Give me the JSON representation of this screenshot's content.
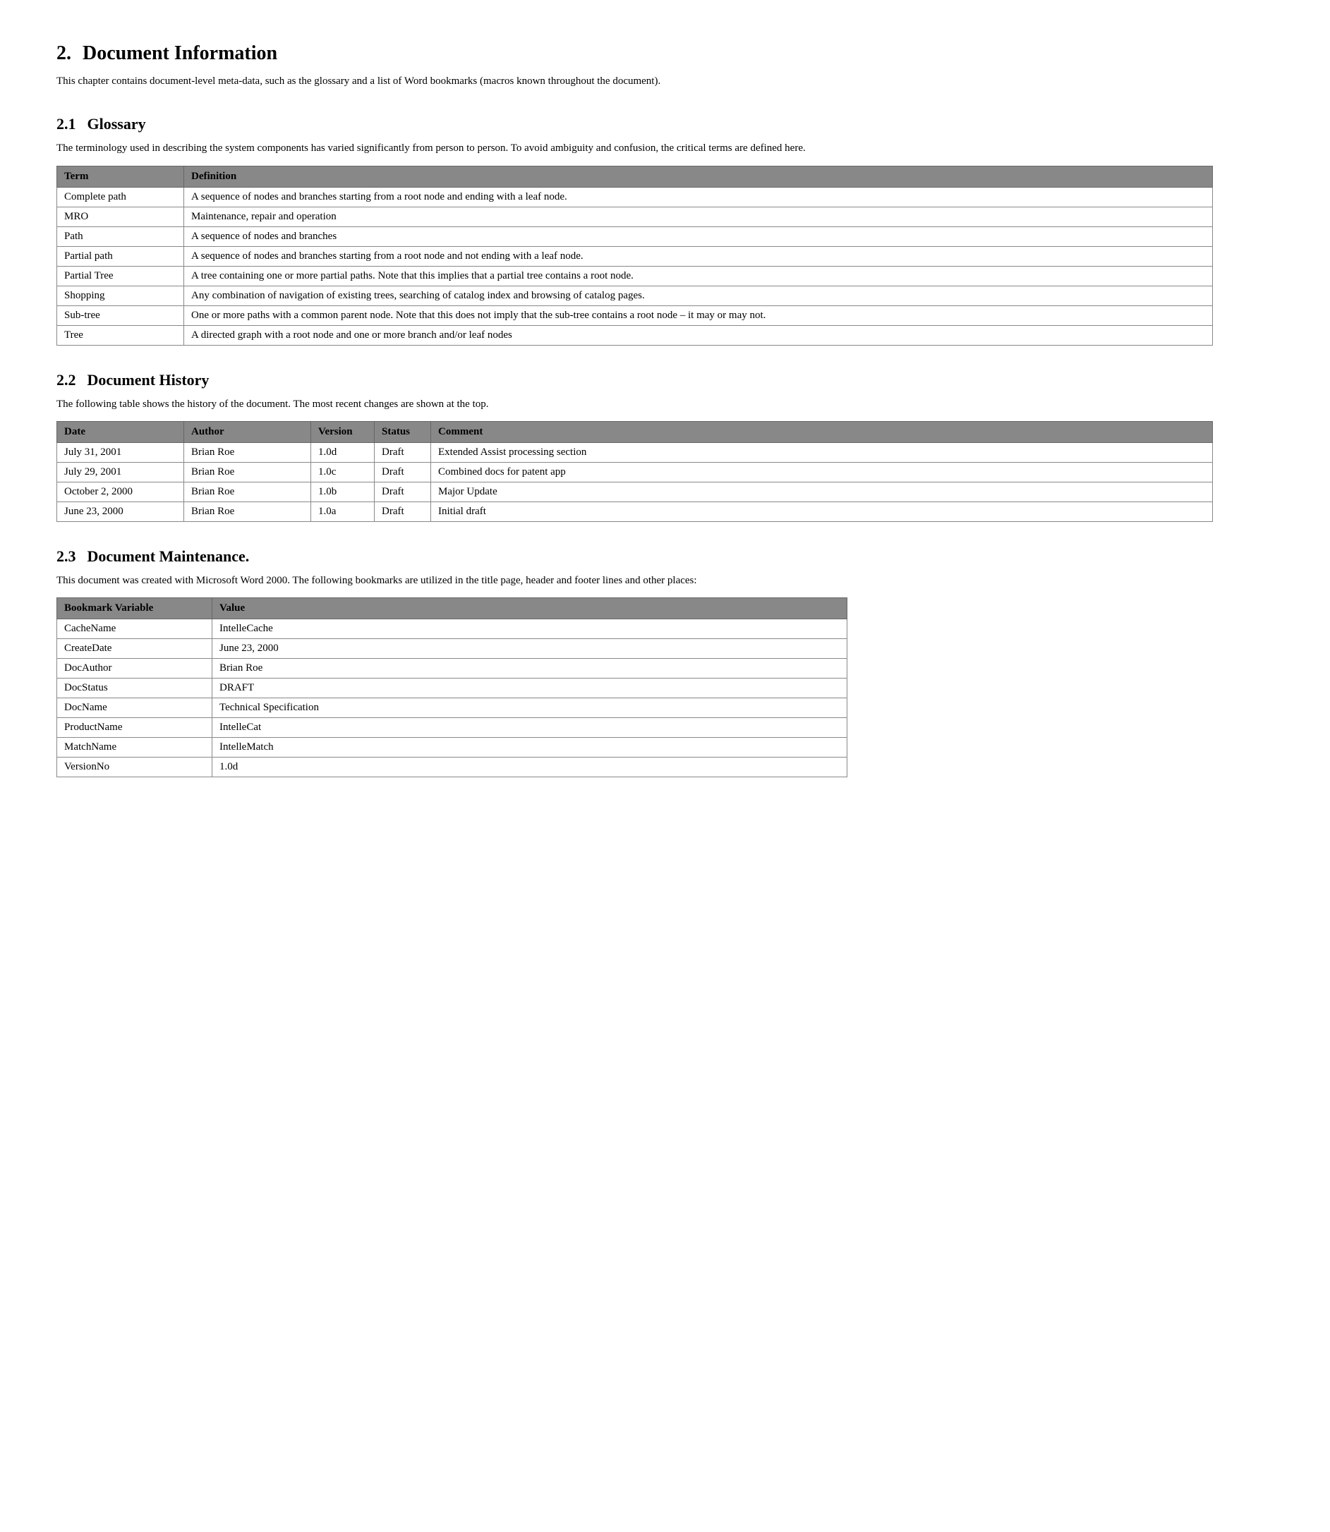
{
  "section": {
    "number": "2.",
    "title": "Document Information",
    "intro": "This chapter contains document-level meta-data, such as the glossary and a list of Word bookmarks (macros known throughout the document)."
  },
  "glossary": {
    "number": "2.1",
    "title": "Glossary",
    "intro": "The terminology used in describing the system components has varied significantly from person to person.  To avoid ambiguity and confusion, the critical terms are defined here.",
    "table_headers": [
      "Term",
      "Definition"
    ],
    "rows": [
      {
        "term": "Complete path",
        "definition": "A sequence of nodes and branches starting from a root node and ending with a leaf node."
      },
      {
        "term": "MRO",
        "definition": "Maintenance, repair and operation"
      },
      {
        "term": "Path",
        "definition": "A sequence of nodes and branches"
      },
      {
        "term": "Partial path",
        "definition": "A sequence of nodes and branches starting from a root node and not ending with a leaf node."
      },
      {
        "term": "Partial Tree",
        "definition": "A tree containing one or more partial paths.  Note that this implies that a partial tree contains a root node."
      },
      {
        "term": "Shopping",
        "definition": "Any combination of navigation of existing trees, searching of catalog index and browsing of catalog pages."
      },
      {
        "term": "Sub-tree",
        "definition": "One or more paths with a common parent node.  Note that this does not imply that the sub-tree contains a root node – it may or may not."
      },
      {
        "term": "Tree",
        "definition": "A directed graph with a root node and one or more branch and/or leaf nodes"
      }
    ]
  },
  "history": {
    "number": "2.2",
    "title": "Document History",
    "intro": "The following table shows the history of the document.  The most recent changes are shown at the top.",
    "table_headers": [
      "Date",
      "Author",
      "Version",
      "Status",
      "Comment"
    ],
    "rows": [
      {
        "date": "July 31, 2001",
        "author": "Brian Roe",
        "version": "1.0d",
        "status": "Draft",
        "comment": "Extended Assist processing section"
      },
      {
        "date": "July 29, 2001",
        "author": "Brian Roe",
        "version": "1.0c",
        "status": "Draft",
        "comment": "Combined docs for patent app"
      },
      {
        "date": "October 2, 2000",
        "author": "Brian Roe",
        "version": "1.0b",
        "status": "Draft",
        "comment": "Major Update"
      },
      {
        "date": "June 23, 2000",
        "author": "Brian Roe",
        "version": "1.0a",
        "status": "Draft",
        "comment": "Initial draft"
      }
    ]
  },
  "maintenance": {
    "number": "2.3",
    "title": "Document Maintenance.",
    "intro": "This document was created with Microsoft Word 2000. The following bookmarks are utilized in the title page, header and footer lines and other places:",
    "table_headers": [
      "Bookmark Variable",
      "Value"
    ],
    "rows": [
      {
        "variable": "CacheName",
        "value": "IntelleCache"
      },
      {
        "variable": "CreateDate",
        "value": "June 23, 2000"
      },
      {
        "variable": "DocAuthor",
        "value": "Brian Roe"
      },
      {
        "variable": "DocStatus",
        "value": "DRAFT"
      },
      {
        "variable": "DocName",
        "value": "Technical Specification"
      },
      {
        "variable": "ProductName",
        "value": "IntelleCat"
      },
      {
        "variable": "MatchName",
        "value": "IntelleMatch"
      },
      {
        "variable": "VersionNo",
        "value": "1.0d"
      }
    ]
  }
}
